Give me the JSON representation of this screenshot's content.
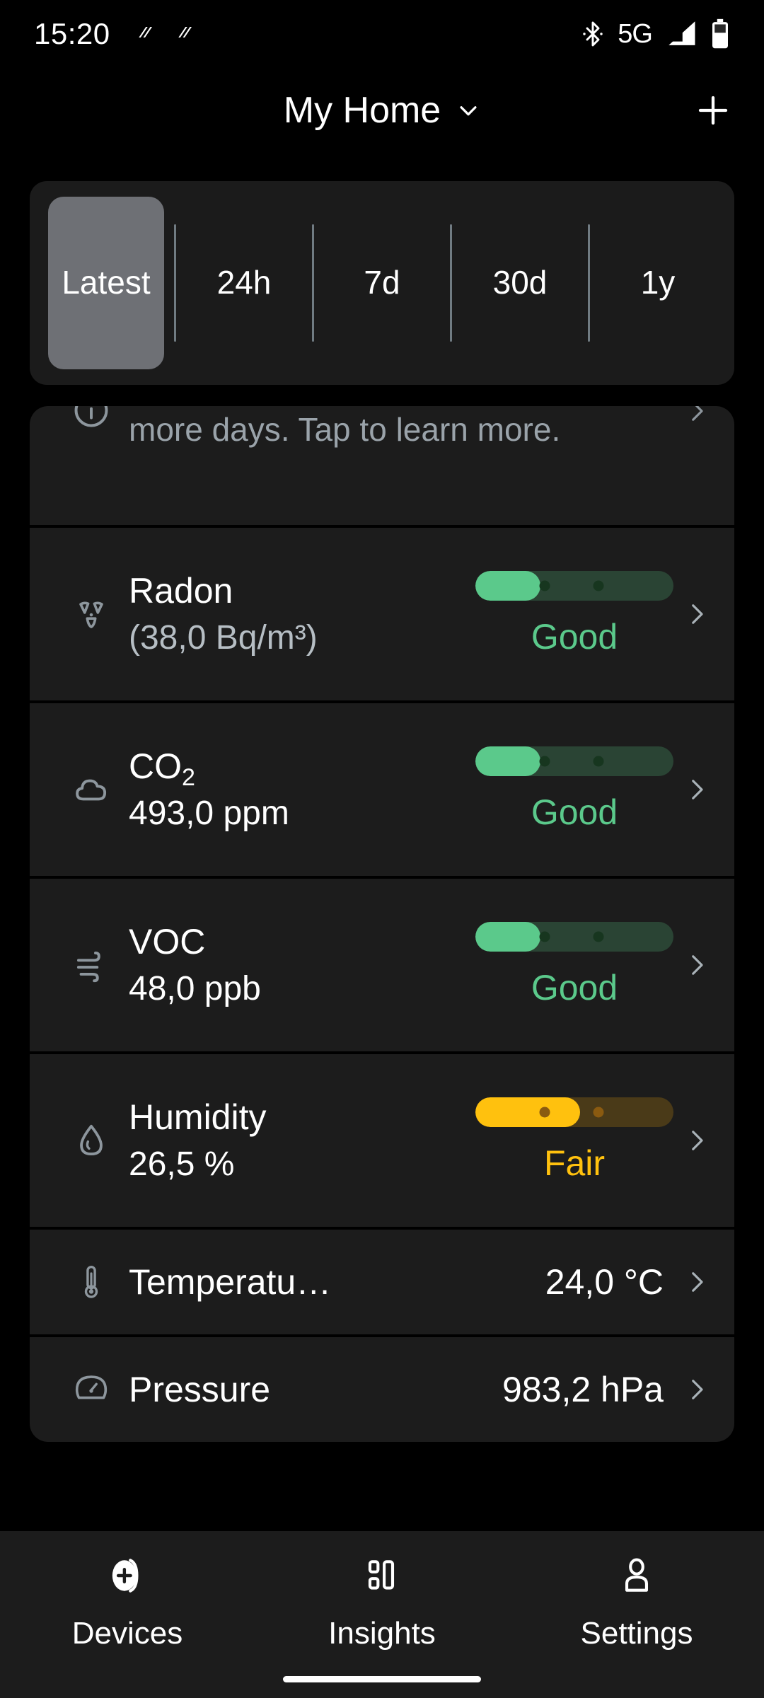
{
  "status_bar": {
    "time": "15:20",
    "network": "5G",
    "icons": [
      "notification-glyph",
      "notification-glyph",
      "bluetooth-icon",
      "signal-icon",
      "battery-icon"
    ]
  },
  "header": {
    "title": "My Home",
    "dropdown_icon": "chevron-down-icon",
    "add_icon": "plus-icon"
  },
  "time_range_tabs": [
    {
      "label": "Latest",
      "selected": true
    },
    {
      "label": "24h",
      "selected": false
    },
    {
      "label": "7d",
      "selected": false
    },
    {
      "label": "30d",
      "selected": false
    },
    {
      "label": "1y",
      "selected": false
    }
  ],
  "notice": {
    "icon": "info-icon",
    "text": "more days. Tap to learn more.",
    "chevron": "chevron-right-icon"
  },
  "sensors": [
    {
      "icon": "radiation-icon",
      "name": "Radon",
      "value": "(38,0 Bq/m³)",
      "value_style": "dim",
      "status": "Good",
      "status_color": "#5BC98B",
      "fill_color": "#5BC98B",
      "track_color": "#2A4434",
      "dot_color": "#17361F",
      "fill_percent": 33,
      "dots": [
        35,
        62
      ]
    },
    {
      "icon": "cloud-icon",
      "name": "CO2",
      "value": "493,0 ppm",
      "value_style": "bright",
      "status": "Good",
      "status_color": "#5BC98B",
      "fill_color": "#5BC98B",
      "track_color": "#2A4434",
      "dot_color": "#17361F",
      "fill_percent": 33,
      "dots": [
        35,
        62
      ]
    },
    {
      "icon": "wind-icon",
      "name": "VOC",
      "value": "48,0 ppb",
      "value_style": "bright",
      "status": "Good",
      "status_color": "#5BC98B",
      "fill_color": "#5BC98B",
      "track_color": "#2A4434",
      "dot_color": "#17361F",
      "fill_percent": 33,
      "dots": [
        35,
        62
      ]
    },
    {
      "icon": "droplet-icon",
      "name": "Humidity",
      "value": "26,5 %",
      "value_style": "bright",
      "status": "Fair",
      "status_color": "#FFC10E",
      "fill_color": "#FFC10E",
      "track_color": "#4A3A18",
      "dot_color": "#8A5A10",
      "fill_percent": 53,
      "dots": [
        35,
        62
      ]
    }
  ],
  "simple_rows": [
    {
      "icon": "thermometer-icon",
      "name": "Temperatu…",
      "value": "24,0 °C"
    },
    {
      "icon": "gauge-icon",
      "name": "Pressure",
      "value": "983,2 hPa"
    }
  ],
  "bottom_nav": [
    {
      "label": "Devices",
      "icon": "device-add-icon",
      "active": true
    },
    {
      "label": "Insights",
      "icon": "insights-icon",
      "active": false
    },
    {
      "label": "Settings",
      "icon": "person-icon",
      "active": false
    }
  ]
}
